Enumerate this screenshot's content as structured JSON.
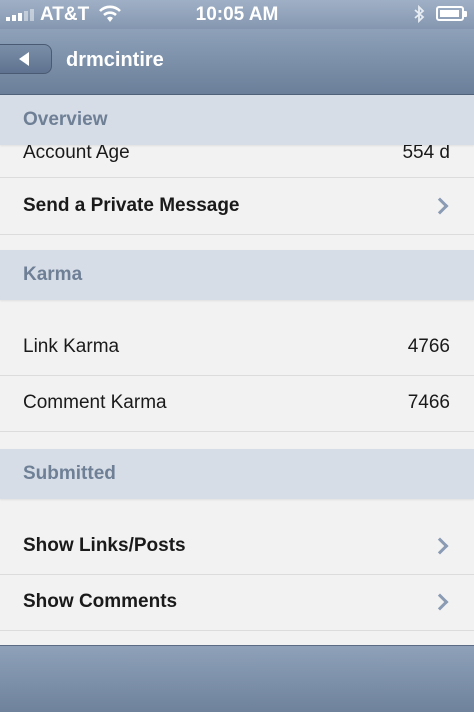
{
  "status_bar": {
    "carrier": "AT&T",
    "time": "10:05 AM",
    "wifi_icon": "wifi-icon",
    "bluetooth_icon": "bluetooth-icon",
    "battery_level": 0.8
  },
  "nav": {
    "title": "drmcintire",
    "back_icon": "back-arrow-icon"
  },
  "sections": {
    "overview": {
      "header": "Overview",
      "partial_row_label": "Account Age",
      "partial_row_value": "554 d",
      "message_label": "Send a Private Message"
    },
    "karma": {
      "header": "Karma",
      "link_label": "Link Karma",
      "link_value": "4766",
      "comment_label": "Comment Karma",
      "comment_value": "7466"
    },
    "submitted": {
      "header": "Submitted",
      "links_label": "Show Links/Posts",
      "comments_label": "Show Comments"
    }
  },
  "colors": {
    "header_bg": "#d6dde7",
    "header_text": "#6f8096",
    "nav_bar": "#7d90aa",
    "chevron": "#8a9bb3"
  }
}
